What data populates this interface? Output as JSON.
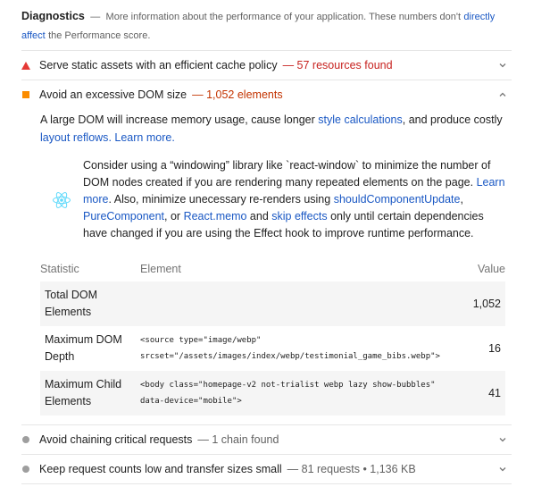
{
  "header": {
    "title": "Diagnostics",
    "dash": "—",
    "desc_prefix": "More information about the performance of your application. These numbers don't",
    "desc_link": "directly affect",
    "desc_suffix": "the Performance score."
  },
  "audits": [
    {
      "title": "Serve static assets with an efficient cache policy",
      "display": "— 57 resources found",
      "severity": "fail",
      "expanded": false
    },
    {
      "title": "Avoid an excessive DOM size",
      "display": "— 1,052 elements",
      "severity": "average",
      "expanded": true,
      "description": {
        "prefix": "A large DOM will increase memory usage, cause longer",
        "link1": "style calculations",
        "middle": ", and produce costly",
        "link2": "layout reflows",
        "sep": ".",
        "link3": "Learn more",
        "end": "."
      },
      "stack_pack": {
        "icon": "react-icon",
        "t1": "Consider using a “windowing” library like `react-window` to minimize the number of DOM nodes created if you are rendering many repeated elements on the page.",
        "link_learn": "Learn more",
        "t2": ". Also, minimize unecessary re-renders using",
        "link_scu": "shouldComponentUpdate",
        "t3": ",",
        "link_pure": "PureComponent",
        "t4": ", or",
        "link_memo": "React.memo",
        "t5": "and",
        "link_skip": "skip effects",
        "t6": "only until certain dependencies have changed if you are using the Effect hook to improve runtime performance."
      },
      "table": {
        "headers": [
          "Statistic",
          "Element",
          "Value"
        ],
        "rows": [
          {
            "statistic": "Total DOM Elements",
            "element": "",
            "value": "1,052"
          },
          {
            "statistic": "Maximum DOM Depth",
            "element_line1": "<source type=\"image/webp\"",
            "element_line2": "srcset=\"/assets/images/index/webp/testimonial_game_bibs.webp\">",
            "value": "16"
          },
          {
            "statistic": "Maximum Child Elements",
            "element_line1": "<body class=\"homepage-v2 not-trialist webp lazy show-bubbles\"",
            "element_line2": "data-device=\"mobile\">",
            "value": "41"
          }
        ]
      }
    },
    {
      "title": "Avoid chaining critical requests",
      "display": "— 1 chain found",
      "severity": "informative",
      "expanded": false
    },
    {
      "title": "Keep request counts low and transfer sizes small",
      "display": "— 81 requests • 1,136 KB",
      "severity": "informative",
      "expanded": false
    }
  ],
  "colors": {
    "fail": "#e53935",
    "average": "#fb8c00",
    "informative": "#9e9e9e",
    "link": "#1a58c4",
    "react": "#61dafb"
  }
}
